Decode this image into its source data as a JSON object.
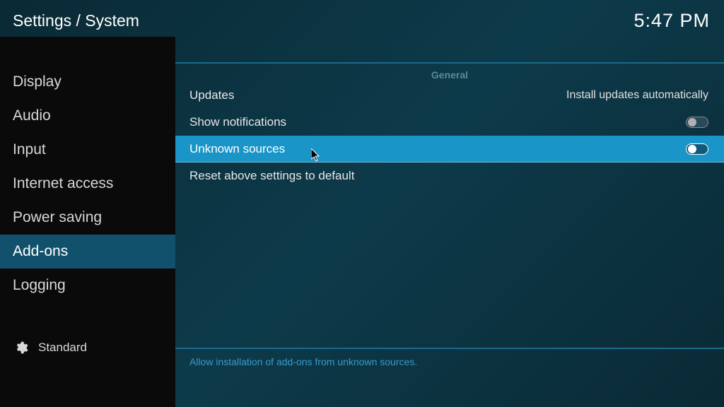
{
  "header": {
    "breadcrumb": "Settings / System",
    "time": "5:47 PM"
  },
  "sidebar": {
    "items": [
      {
        "label": "Display",
        "selected": false
      },
      {
        "label": "Audio",
        "selected": false
      },
      {
        "label": "Input",
        "selected": false
      },
      {
        "label": "Internet access",
        "selected": false
      },
      {
        "label": "Power saving",
        "selected": false
      },
      {
        "label": "Add-ons",
        "selected": true
      },
      {
        "label": "Logging",
        "selected": false
      }
    ],
    "level_label": "Standard"
  },
  "main": {
    "section_header": "General",
    "settings": [
      {
        "label": "Updates",
        "value": "Install updates automatically",
        "type": "select",
        "highlight": false
      },
      {
        "label": "Show notifications",
        "value": "off",
        "type": "toggle",
        "highlight": false
      },
      {
        "label": "Unknown sources",
        "value": "off",
        "type": "toggle",
        "highlight": true
      },
      {
        "label": "Reset above settings to default",
        "value": "",
        "type": "action",
        "highlight": false
      }
    ],
    "hint": "Allow installation of add-ons from unknown sources."
  }
}
